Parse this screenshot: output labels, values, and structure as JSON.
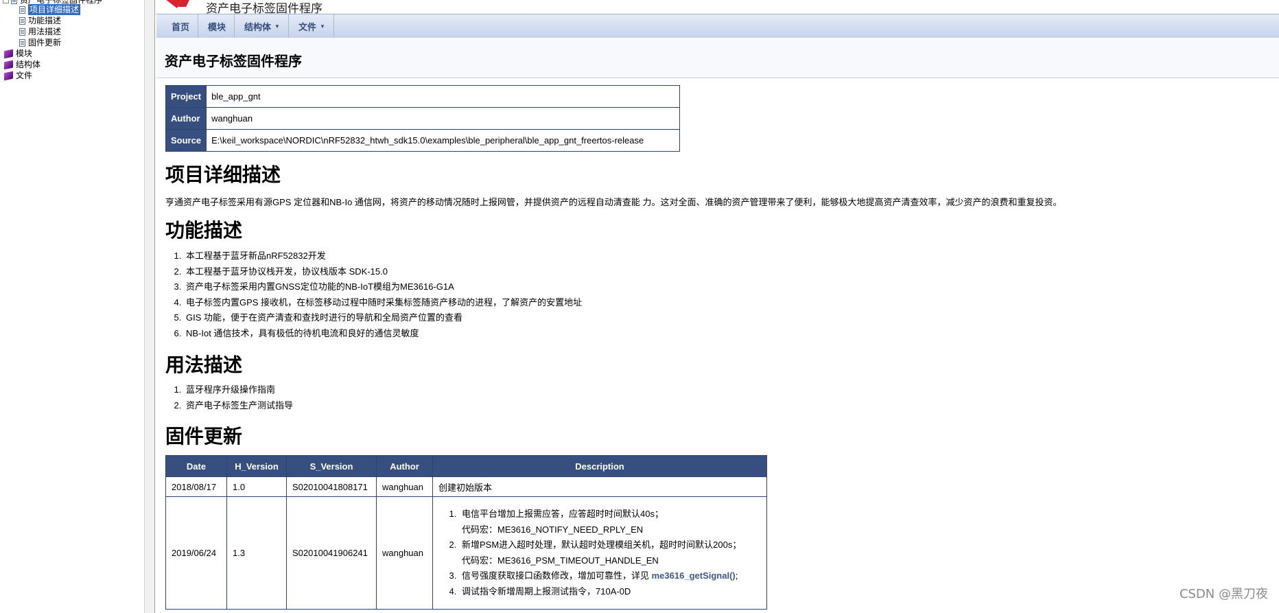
{
  "tree": {
    "root_label": "资产电子标签固件程序",
    "items": [
      {
        "label": "项目详细描述",
        "selected": true,
        "icon": "doc-icon"
      },
      {
        "label": "功能描述",
        "icon": "doc-icon"
      },
      {
        "label": "用法描述",
        "icon": "doc-icon"
      },
      {
        "label": "固件更新",
        "icon": "doc-icon"
      }
    ],
    "sections": [
      {
        "label": "模块",
        "icon": "book-icon"
      },
      {
        "label": "结构体",
        "icon": "book-icon"
      },
      {
        "label": "文件",
        "icon": "book-icon"
      }
    ]
  },
  "header": {
    "project_name": "资产电子标签固件程序"
  },
  "navbar": {
    "items": [
      {
        "label": "首页"
      },
      {
        "label": "模块"
      },
      {
        "label": "结构体",
        "dropdown": "▼"
      },
      {
        "label": "文件",
        "dropdown": "▼"
      }
    ]
  },
  "page": {
    "title": "资产电子标签固件程序"
  },
  "info": {
    "project_label": "Project",
    "project_value": "ble_app_gnt",
    "author_label": "Author",
    "author_value": "wanghuan",
    "source_label": "Source",
    "source_value": "E:\\keil_workspace\\NORDIC\\nRF52832_htwh_sdk15.0\\examples\\ble_peripheral\\ble_app_gnt_freertos-release"
  },
  "sections": {
    "detail_heading": "项目详细描述",
    "detail_text": "亨通资产电子标签采用有源GPS 定位器和NB-Io 通信网，将资产的移动情况随时上报网管，并提供资产的远程自动清查能 力。这对全面、准确的资产管理带来了便利，能够极大地提高资产清查效率，减少资产的浪费和重复投资。",
    "feature_heading": "功能描述",
    "features": [
      "本工程基于蓝牙新品nRF52832开发",
      "本工程基于蓝牙协议栈开发，协议栈版本 SDK-15.0",
      "资产电子标签采用内置GNSS定位功能的NB-IoT模组为ME3616-G1A",
      "电子标签内置GPS 接收机，在标签移动过程中随时采集标签随资产移动的进程，了解资产的安置地址",
      "GIS 功能，便于在资产清查和查找时进行的导航和全局资产位置的查看",
      "NB-Iot 通信技术，具有极低的待机电流和良好的通信灵敏度"
    ],
    "usage_heading": "用法描述",
    "usages": [
      "蓝牙程序升级操作指南",
      "资产电子标签生产测试指导"
    ],
    "firmware_heading": "固件更新"
  },
  "firmware_table": {
    "headers": [
      "Date",
      "H_Version",
      "S_Version",
      "Author",
      "Description"
    ],
    "row1": {
      "date": "2018/08/17",
      "hver": "1.0",
      "sver": "S02010041808171",
      "author": "wanghuan",
      "desc": "创建初始版本"
    },
    "row2": {
      "date": "2019/06/24",
      "hver": "1.3",
      "sver": "S02010041906241",
      "author": "wanghuan",
      "d1a": "电信平台增加上报需应答，应答超时时间默认40s；",
      "d1b": "代码宏：ME3616_NOTIFY_NEED_RPLY_EN",
      "d2a": "新增PSM进入超时处理，默认超时处理模组关机，超时时间默认200s；",
      "d2b": "代码宏：ME3616_PSM_TIMEOUT_HANDLE_EN",
      "d3a": "信号强度获取接口函数修改，增加可靠性，详见 ",
      "d3link": "me3616_getSignal()",
      "d3c": ";",
      "d4": "调试指令新增周期上报测试指令，710A-0D"
    }
  },
  "watermark": "CSDN @黑刀夜"
}
